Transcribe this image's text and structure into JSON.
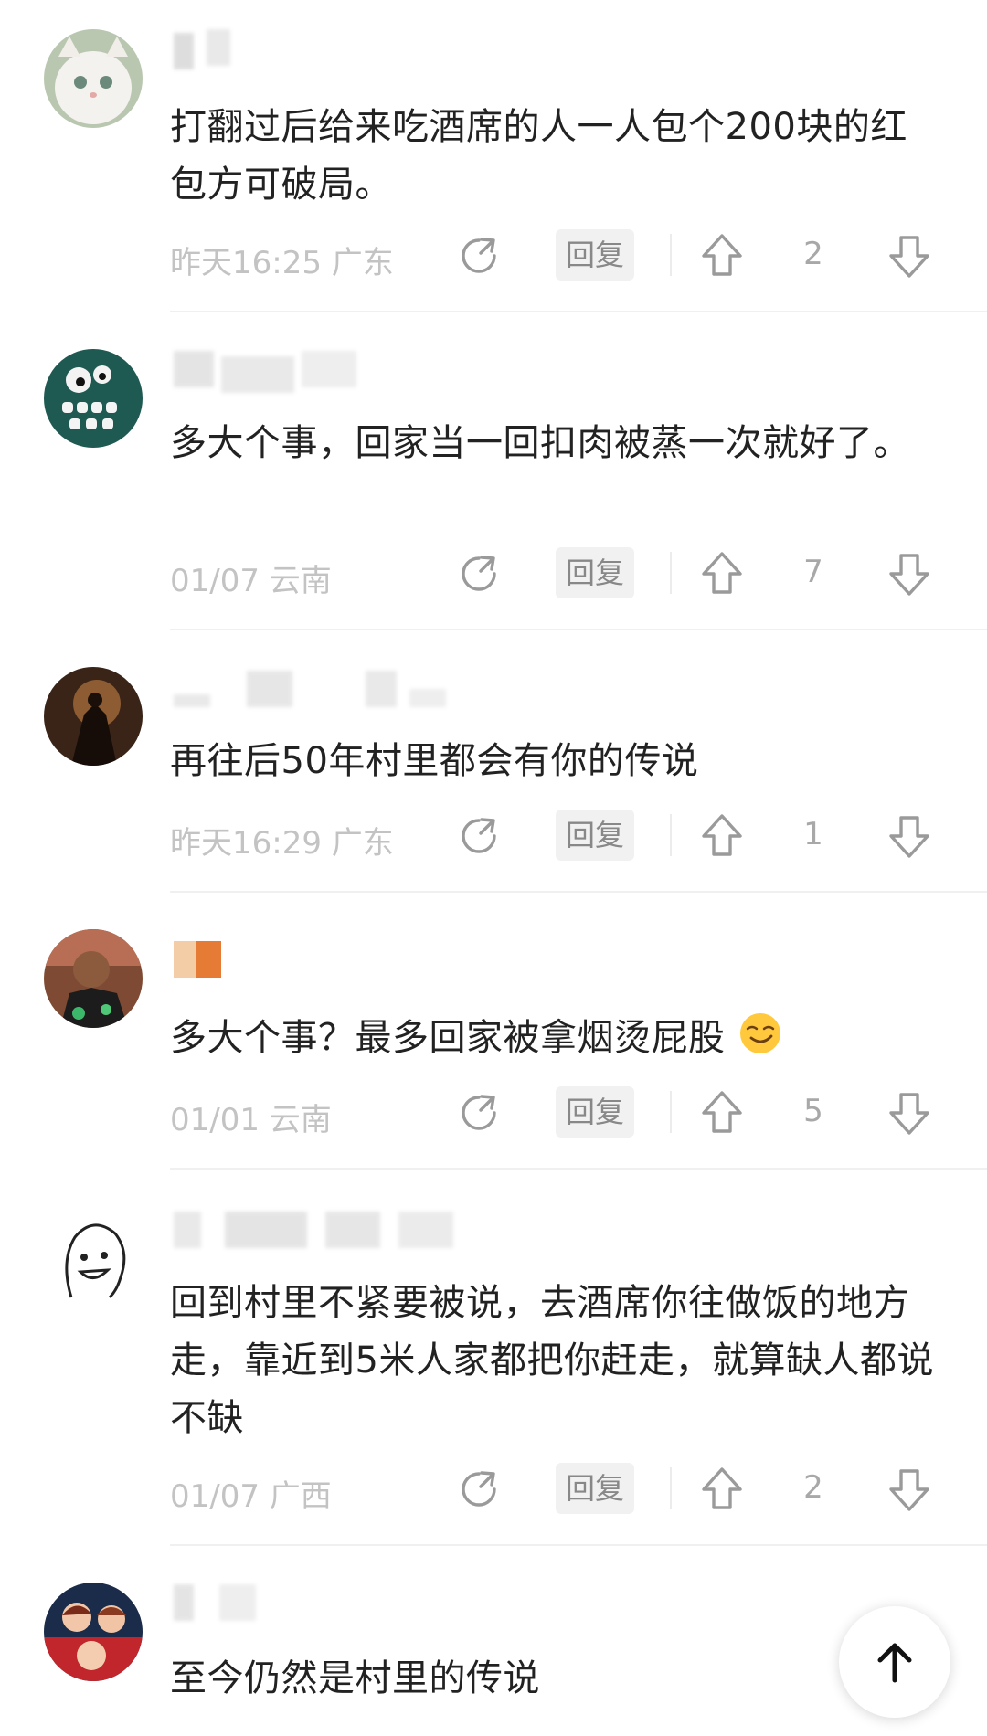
{
  "comments": [
    {
      "text": "打翻过后给来吃酒席的人一人包个200块的红包方可破局。",
      "time": "昨天16:25",
      "location": "广东",
      "votes": "2",
      "reply_label": "回复"
    },
    {
      "text": "多大个事，回家当一回扣肉被蒸一次就好了。",
      "time": "01/07",
      "location": "云南",
      "votes": "7",
      "reply_label": "回复"
    },
    {
      "text": "再往后50年村里都会有你的传说",
      "time": "昨天16:29",
      "location": "广东",
      "votes": "1",
      "reply_label": "回复"
    },
    {
      "text": "多大个事？最多回家被拿烟烫屁股",
      "time": "01/01",
      "location": "云南",
      "votes": "5",
      "reply_label": "回复",
      "emoji_icon": "smirk-emoji-icon"
    },
    {
      "text": "回到村里不紧要被说，去酒席你往做饭的地方走，靠近到5米人家都把你赶走，就算缺人都说不缺",
      "time": "01/07",
      "location": "广西",
      "votes": "2",
      "reply_label": "回复"
    },
    {
      "text": "至今仍然是村里的传说"
    }
  ],
  "icons": {
    "share": "share-icon",
    "upvote": "upvote-arrow-icon",
    "downvote": "downvote-arrow-icon",
    "scroll_top": "arrow-up-icon"
  },
  "colors": {
    "text": "#222222",
    "meta": "#c3c3c3",
    "icon": "#9a9a9a",
    "reply_bg": "#f1f1f1"
  }
}
